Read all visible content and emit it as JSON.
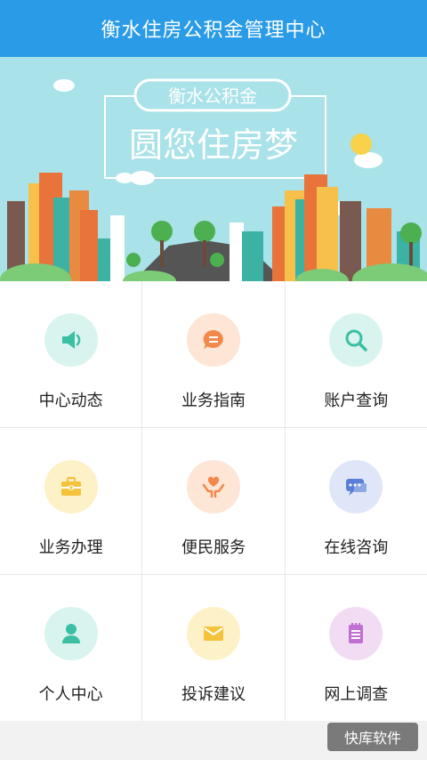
{
  "header": {
    "title": "衡水住房公积金管理中心"
  },
  "banner": {
    "sign_top": "衡水公积金",
    "sign_main": "圆您住房梦"
  },
  "menu": [
    {
      "label": "中心动态",
      "icon": "speaker-icon",
      "bg": "#d9f4ef",
      "color": "#3bbfa2"
    },
    {
      "label": "业务指南",
      "icon": "chat-bubble-icon",
      "bg": "#fde6d6",
      "color": "#f2894a"
    },
    {
      "label": "账户查询",
      "icon": "search-icon",
      "bg": "#d9f4ef",
      "color": "#3bbfa2"
    },
    {
      "label": "业务办理",
      "icon": "briefcase-icon",
      "bg": "#fdf1c7",
      "color": "#f5c33b"
    },
    {
      "label": "便民服务",
      "icon": "heart-hands-icon",
      "bg": "#fde6d6",
      "color": "#f2894a"
    },
    {
      "label": "在线咨询",
      "icon": "message-icon",
      "bg": "#dfe6f8",
      "color": "#5b7fd6"
    },
    {
      "label": "个人中心",
      "icon": "person-icon",
      "bg": "#d9f4ef",
      "color": "#3bbfa2"
    },
    {
      "label": "投诉建议",
      "icon": "envelope-icon",
      "bg": "#fdf1c7",
      "color": "#f5c33b"
    },
    {
      "label": "网上调查",
      "icon": "notepad-icon",
      "bg": "#f1dcf4",
      "color": "#c06fd3"
    }
  ],
  "watermark": {
    "text": "快库软件"
  }
}
